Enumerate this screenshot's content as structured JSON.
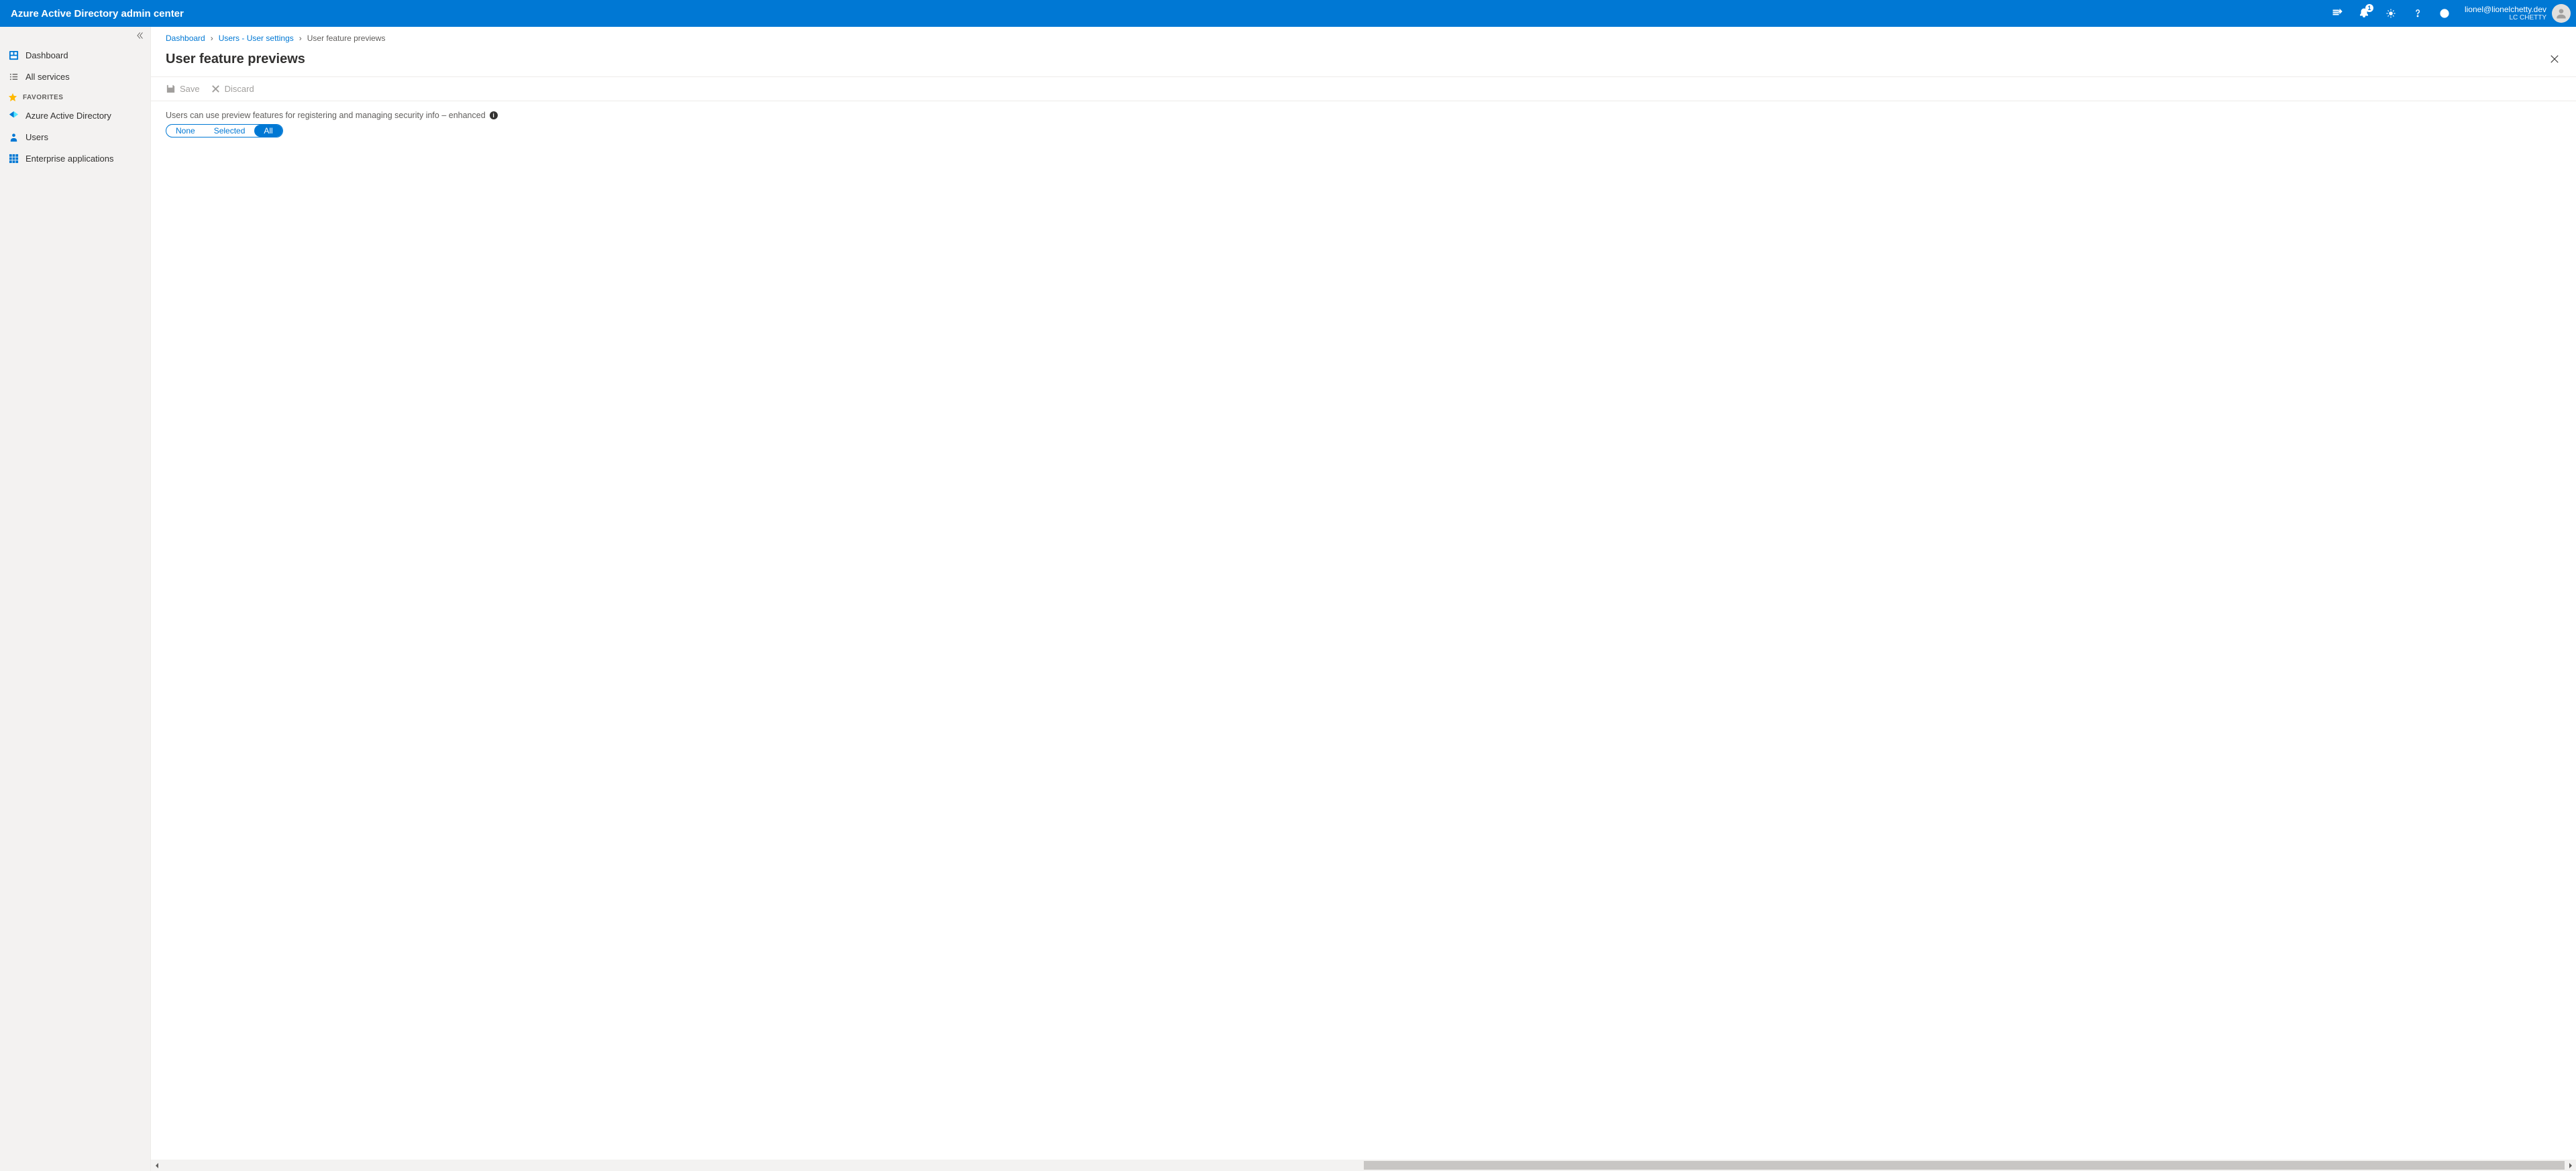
{
  "header": {
    "title": "Azure Active Directory admin center",
    "notifications_badge": "1",
    "user_email": "lionel@lionelchetty.dev",
    "user_org": "LC CHETTY"
  },
  "sidebar": {
    "items": {
      "dashboard": "Dashboard",
      "all_services": "All services",
      "aad": "Azure Active Directory",
      "users": "Users",
      "enterprise_apps": "Enterprise applications"
    },
    "favorites_label": "FAVORITES"
  },
  "breadcrumb": {
    "dashboard": "Dashboard",
    "users_settings": "Users - User settings",
    "current": "User feature previews"
  },
  "page": {
    "title": "User feature previews"
  },
  "cmdbar": {
    "save": "Save",
    "discard": "Discard"
  },
  "setting": {
    "label": "Users can use preview features for registering and managing security info – enhanced",
    "options": {
      "none": "None",
      "selected": "Selected",
      "all": "All"
    },
    "active": "all"
  }
}
